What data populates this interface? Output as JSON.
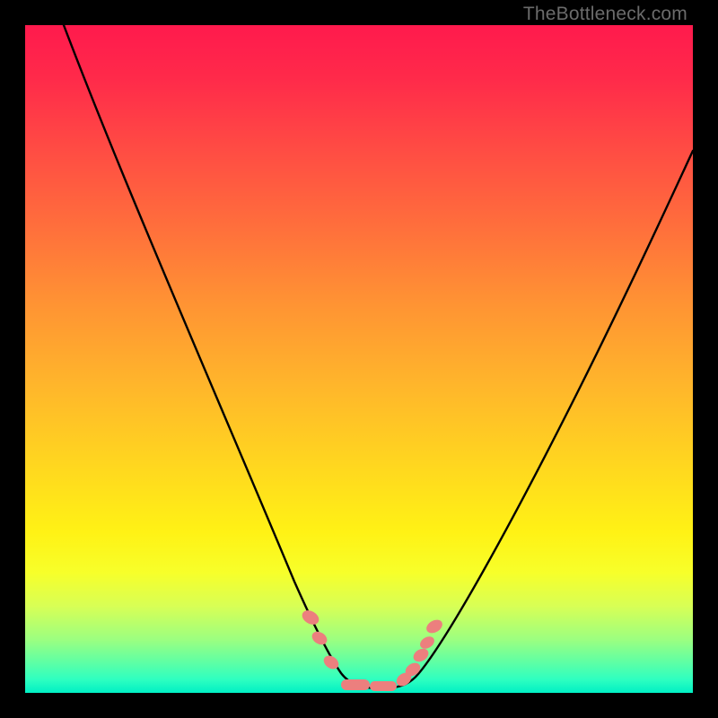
{
  "watermark": "TheBottleneck.com",
  "chart_data": {
    "type": "line",
    "title": "",
    "xlabel": "",
    "ylabel": "",
    "xlim": [
      0,
      100
    ],
    "ylim": [
      0,
      100
    ],
    "grid": false,
    "legend": false,
    "series": [
      {
        "name": "bottleneck-curve",
        "x": [
          0,
          5,
          10,
          15,
          20,
          25,
          30,
          35,
          38,
          41,
          44,
          47,
          49,
          51,
          53,
          55,
          58,
          62,
          66,
          70,
          75,
          80,
          85,
          90,
          95,
          100
        ],
        "y": [
          112,
          101,
          90,
          79,
          68,
          57,
          46,
          35,
          26,
          17,
          8.5,
          3.2,
          1.2,
          0.7,
          0.7,
          1.0,
          2.6,
          8.0,
          15,
          22,
          30,
          38,
          46,
          54,
          62,
          70
        ]
      }
    ],
    "markers": {
      "name": "highlighted-points",
      "color": "#ec7f7e",
      "points": [
        {
          "x": 43,
          "y": 10.0
        },
        {
          "x": 44.5,
          "y": 7.0
        },
        {
          "x": 46.5,
          "y": 3.8
        },
        {
          "x": 49,
          "y": 1.2,
          "type": "bar"
        },
        {
          "x": 53,
          "y": 0.7,
          "type": "bar"
        },
        {
          "x": 56.5,
          "y": 1.7
        },
        {
          "x": 58,
          "y": 2.6
        },
        {
          "x": 59.2,
          "y": 4.4
        },
        {
          "x": 60.0,
          "y": 6.0
        },
        {
          "x": 61.2,
          "y": 8.2
        }
      ]
    },
    "background_gradient": {
      "top": "#ff1a4d",
      "mid": "#ffd71f",
      "bottom": "#00f0c4"
    },
    "frame_color": "#000000"
  }
}
